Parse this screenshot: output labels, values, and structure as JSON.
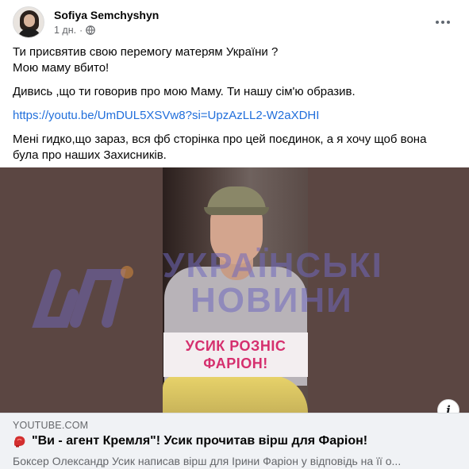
{
  "post": {
    "author": "Sofiya Semchyshyn",
    "time": "1 дн.",
    "separator": "·",
    "icons": {
      "privacy": "globe-icon",
      "menu": "more-options-icon"
    }
  },
  "body": {
    "line1": "Ти присвятив свою перемогу матерям України ?",
    "line2": "Мою маму вбито!",
    "line3": "Дивись ,що ти говорив про мою Маму. Ти нашу сім'ю образив.",
    "link": "https://youtu.be/UmDUL5XSVw8?si=UpzAzLL2-W2aXDHI",
    "line4a": "Мені гидко,що зараз, вся фб сторінка про цей поєдинок, а я хочу щоб вона",
    "line4b": "була про наших Захисників."
  },
  "preview": {
    "caption_line1": "УСИК РОЗНІС",
    "caption_line2": "ФАРІОН!",
    "watermark_line1": "УКРАЇНСЬКІ",
    "watermark_line2": "НОВИНИ",
    "info_label": "i",
    "accent_color": "#d52f6e"
  },
  "card": {
    "domain": "YOUTUBE.COM",
    "title": "\"Ви - агент Кремля\"! Усик прочитав вірш для Фаріон!",
    "description": "Боксер Олександр Усик написав вірш для Ірини Фаріон у відповідь на її о..."
  }
}
